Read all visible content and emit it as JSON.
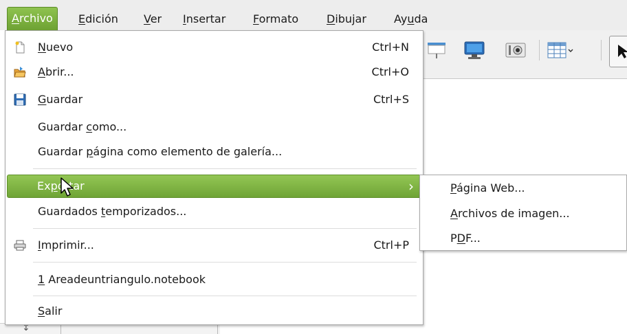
{
  "menubar": {
    "items": [
      {
        "pre": "",
        "key": "A",
        "post": "rchivo"
      },
      {
        "pre": "",
        "key": "E",
        "post": "dición"
      },
      {
        "pre": "",
        "key": "V",
        "post": "er"
      },
      {
        "pre": "",
        "key": "I",
        "post": "nsertar"
      },
      {
        "pre": "",
        "key": "F",
        "post": "ormato"
      },
      {
        "pre": "",
        "key": "D",
        "post": "ibujar"
      },
      {
        "pre": "Ay",
        "key": "u",
        "post": "da"
      }
    ]
  },
  "menu": {
    "nuevo": {
      "pre": "",
      "key": "N",
      "post": "uevo",
      "shortcut": "Ctrl+N",
      "icon": "new-document-icon"
    },
    "abrir": {
      "pre": "",
      "key": "A",
      "post": "brir...",
      "shortcut": "Ctrl+O",
      "icon": "open-folder-icon"
    },
    "guardar": {
      "pre": "",
      "key": "G",
      "post": "uardar",
      "shortcut": "Ctrl+S",
      "icon": "floppy-disk-icon"
    },
    "guardar_como": {
      "pre": "Guardar ",
      "key": "c",
      "post": "omo..."
    },
    "guardar_galeria": {
      "pre": "Guardar ",
      "key": "p",
      "post": "ágina como elemento de galería..."
    },
    "exportar": {
      "pre": "Ex",
      "key": "p",
      "post": "ortar",
      "chevron": "›"
    },
    "guardados": {
      "pre": "Guardados ",
      "key": "t",
      "post": "emporizados..."
    },
    "imprimir": {
      "pre": "",
      "key": "I",
      "post": "mprimir...",
      "shortcut": "Ctrl+P",
      "icon": "printer-icon"
    },
    "reciente": {
      "pre": "",
      "key": "1",
      "post": " Areadeuntriangulo.notebook"
    },
    "salir": {
      "pre": "",
      "key": "S",
      "post": "alir"
    }
  },
  "submenu": {
    "pagina_web": {
      "pre": "",
      "key": "P",
      "post": "ágina Web..."
    },
    "archivos_imagen": {
      "pre": "",
      "key": "A",
      "post": "rchivos de imagen..."
    },
    "pdf": {
      "pre": "P",
      "key": "D",
      "post": "F..."
    }
  },
  "colors": {
    "highlight": "#7ab03f",
    "menubar_bg": "#ededed"
  }
}
